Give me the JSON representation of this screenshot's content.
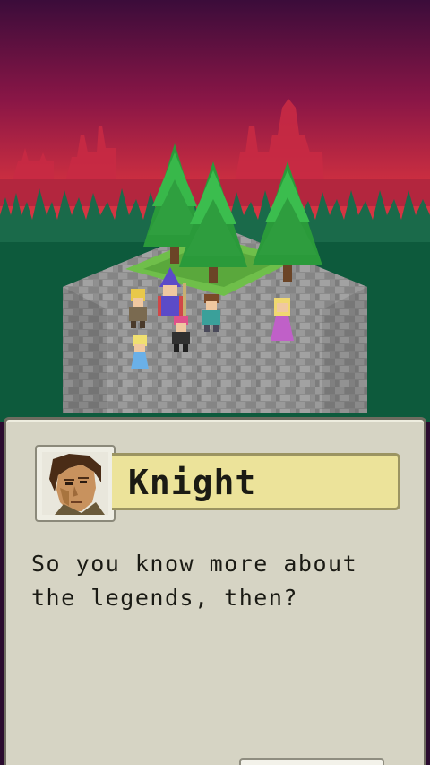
{
  "dialog": {
    "speaker": "Knight",
    "text": "So you know more about\nthe legends, then?"
  },
  "icons": {
    "portrait": "knight-portrait",
    "continue": "continue-indicator"
  },
  "colors": {
    "sky_top": "#3a0e3a",
    "sky_bottom": "#d8333f",
    "forest": "#0f5a3e",
    "panel": "#d6d4c4",
    "nameplate": "#ece39a"
  }
}
